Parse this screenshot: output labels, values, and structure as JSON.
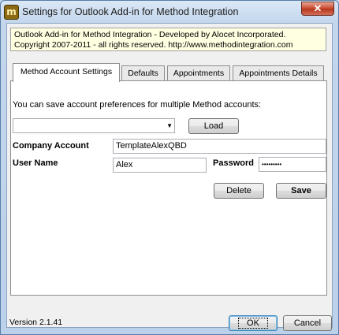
{
  "window": {
    "title": "Settings for Outlook Add-in for Method Integration",
    "icon_letter": "m",
    "close_glyph": "✕"
  },
  "info": {
    "line1": "Outlook Add-in for Method Integration - Developed by Alocet Incorporated.",
    "line2": "Copyright 2007-2011 - all rights reserved.  http://www.methodintegration.com"
  },
  "tabs": [
    {
      "label": "Method Account Settings",
      "active": true
    },
    {
      "label": "Defaults",
      "active": false
    },
    {
      "label": "Appointments",
      "active": false
    },
    {
      "label": "Appointments Details",
      "active": false
    }
  ],
  "panel": {
    "description": "You can save account preferences for multiple Method accounts:",
    "account_select": {
      "value": "",
      "arrow": "▼"
    },
    "load_label": "Load",
    "company_account_label": "Company Account",
    "company_account_value": "TemplateAlexQBD",
    "user_name_label": "User Name",
    "user_name_value": "Alex",
    "password_label": "Password",
    "password_value": "•••••••••",
    "delete_label": "Delete",
    "save_label": "Save"
  },
  "footer": {
    "version": "Version 2.1.41",
    "ok_label": "OK",
    "cancel_label": "Cancel"
  }
}
